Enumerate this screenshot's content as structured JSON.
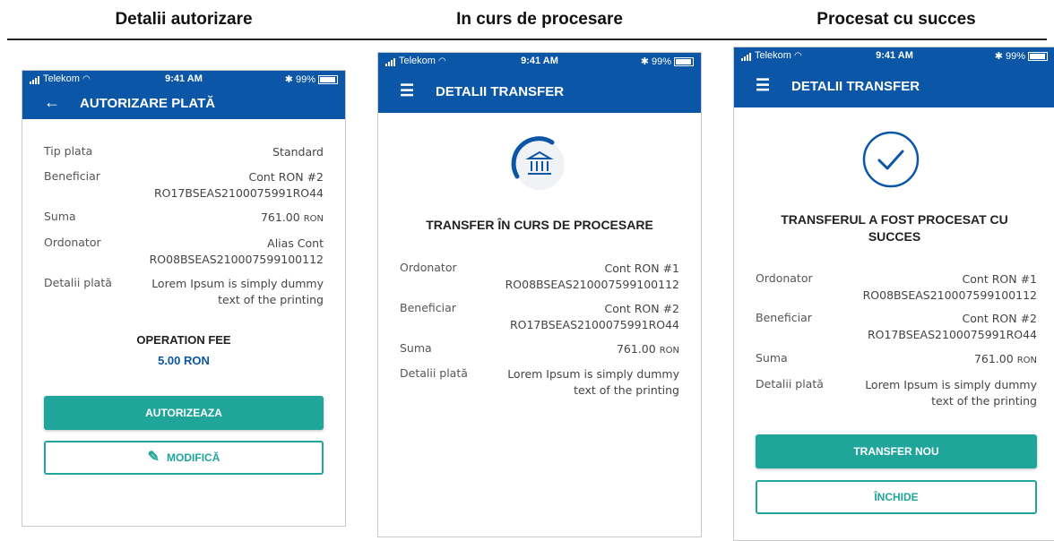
{
  "columns": {
    "c1": "Detalii autorizare",
    "c2": "In curs de procesare",
    "c3": "Procesat cu succes"
  },
  "status": {
    "carrier": "Telekom",
    "time": "9:41 AM",
    "battery": "99%"
  },
  "screen1": {
    "title": "AUTORIZARE PLATĂ",
    "rows": {
      "tip_label": "Tip plata",
      "tip_value": "Standard",
      "benef_label": "Beneficiar",
      "benef_line1": "Cont RON #2",
      "benef_line2": "RO17BSEAS2100075991RO44",
      "suma_label": "Suma",
      "suma_value": "761.00",
      "suma_currency": "RON",
      "ord_label": "Ordonator",
      "ord_line1": "Alias Cont",
      "ord_line2": "RO08BSEAS210007599100112",
      "det_label": "Detalii plată",
      "det_line1": "Lorem Ipsum is simply dummy",
      "det_line2": "text of the printing"
    },
    "fee_label": "OPERATION FEE",
    "fee_value": "5.00 RON",
    "btn_authorize": "AUTORIZEAZA",
    "btn_modify": "MODIFICĂ"
  },
  "screen2": {
    "title": "DETALII TRANSFER",
    "heading": "TRANSFER ÎN CURS DE PROCESARE",
    "rows": {
      "ord_label": "Ordonator",
      "ord_line1": "Cont RON #1",
      "ord_line2": "RO08BSEAS210007599100112",
      "benef_label": "Beneficiar",
      "benef_line1": "Cont RON #2",
      "benef_line2": "RO17BSEAS2100075991RO44",
      "suma_label": "Suma",
      "suma_value": "761.00",
      "suma_currency": "RON",
      "det_label": "Detalii plată",
      "det_line1": "Lorem Ipsum is simply dummy",
      "det_line2": "text of the printing"
    }
  },
  "screen3": {
    "title": "DETALII TRANSFER",
    "heading_line1": "TRANSFERUL A FOST PROCESAT CU",
    "heading_line2": "SUCCES",
    "rows": {
      "ord_label": "Ordonator",
      "ord_line1": "Cont RON #1",
      "ord_line2": "RO08BSEAS210007599100112",
      "benef_label": "Beneficiar",
      "benef_line1": "Cont RON #2",
      "benef_line2": "RO17BSEAS2100075991RO44",
      "suma_label": "Suma",
      "suma_value": "761.00",
      "suma_currency": "RON",
      "det_label": "Detalii plată",
      "det_line1": "Lorem Ipsum is simply dummy",
      "det_line2": "text of the printing"
    },
    "btn_new": "TRANSFER NOU",
    "btn_close": "ÎNCHIDE"
  },
  "colors": {
    "primary": "#0b56a6",
    "accent": "#1fa59a",
    "fee": "#0b56a6"
  },
  "icons": {
    "back": "arrow-left-icon",
    "menu": "hamburger-menu-icon",
    "bank": "bank-icon",
    "check": "check-circle-icon",
    "edit": "pencil-icon"
  }
}
